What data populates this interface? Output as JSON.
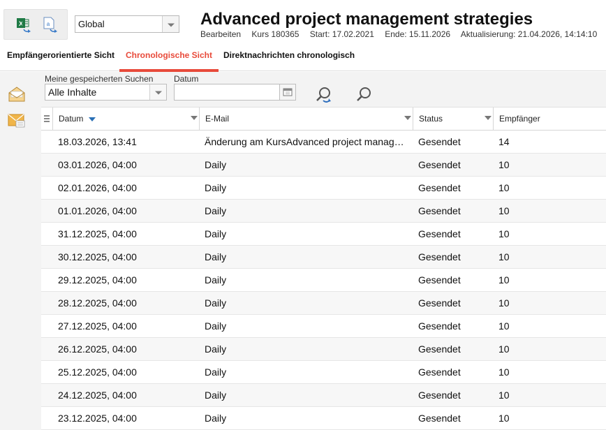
{
  "header": {
    "scope_value": "Global",
    "course_title": "Advanced project management strategies",
    "meta": {
      "edit": "Bearbeiten",
      "course_no": "Kurs 180365",
      "start": "Start: 17.02.2021",
      "end": "Ende: 15.11.2026",
      "updated": "Aktualisierung: 21.04.2026, 14:14:10"
    }
  },
  "toolbar": {
    "icons": [
      "excel-export-icon",
      "document-export-icon"
    ]
  },
  "tabs": [
    {
      "label": "Empfängerorientierte Sicht",
      "active": false
    },
    {
      "label": "Chronologische Sicht",
      "active": true
    },
    {
      "label": "Direktnachrichten chronologisch",
      "active": false
    }
  ],
  "filter": {
    "saved_search_label": "Meine gespeicherten Suchen",
    "saved_search_value": "Alle Inhalte",
    "date_label": "Datum",
    "date_value": ""
  },
  "grid": {
    "columns": {
      "date": "Datum",
      "email": "E-Mail",
      "status": "Status",
      "recipients": "Empfänger"
    },
    "sort": {
      "column": "date",
      "direction": "desc"
    },
    "rows": [
      {
        "date": "18.03.2026, 13:41",
        "email": "Änderung am KursAdvanced project management strategies",
        "status": "Gesendet",
        "recipients": "14"
      },
      {
        "date": "03.01.2026, 04:00",
        "email": "Daily",
        "status": "Gesendet",
        "recipients": "10"
      },
      {
        "date": "02.01.2026, 04:00",
        "email": "Daily",
        "status": "Gesendet",
        "recipients": "10"
      },
      {
        "date": "01.01.2026, 04:00",
        "email": "Daily",
        "status": "Gesendet",
        "recipients": "10"
      },
      {
        "date": "31.12.2025, 04:00",
        "email": "Daily",
        "status": "Gesendet",
        "recipients": "10"
      },
      {
        "date": "30.12.2025, 04:00",
        "email": "Daily",
        "status": "Gesendet",
        "recipients": "10"
      },
      {
        "date": "29.12.2025, 04:00",
        "email": "Daily",
        "status": "Gesendet",
        "recipients": "10"
      },
      {
        "date": "28.12.2025, 04:00",
        "email": "Daily",
        "status": "Gesendet",
        "recipients": "10"
      },
      {
        "date": "27.12.2025, 04:00",
        "email": "Daily",
        "status": "Gesendet",
        "recipients": "10"
      },
      {
        "date": "26.12.2025, 04:00",
        "email": "Daily",
        "status": "Gesendet",
        "recipients": "10"
      },
      {
        "date": "25.12.2025, 04:00",
        "email": "Daily",
        "status": "Gesendet",
        "recipients": "10"
      },
      {
        "date": "24.12.2025, 04:00",
        "email": "Daily",
        "status": "Gesendet",
        "recipients": "10"
      },
      {
        "date": "23.12.2025, 04:00",
        "email": "Daily",
        "status": "Gesendet",
        "recipients": "10"
      }
    ]
  },
  "colors": {
    "accent": "#e84a3a",
    "sort_arrow": "#2a6fb5",
    "excel_green": "#1f7a45",
    "export_blue": "#3a7bc8",
    "rail_orange": "#f0b54a"
  }
}
